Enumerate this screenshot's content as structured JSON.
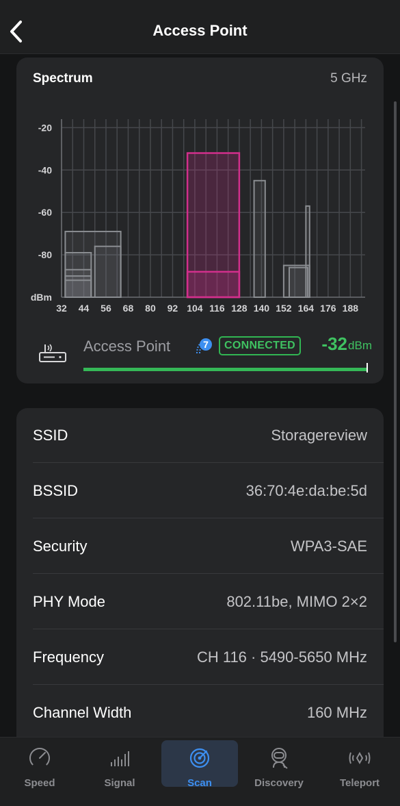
{
  "header": {
    "title": "Access Point",
    "back_icon": "chevron-left-icon"
  },
  "spectrum": {
    "title": "Spectrum",
    "band": "5 GHz",
    "chart_data": {
      "type": "bar",
      "xlabel": "",
      "ylabel": "dBm",
      "x_ticks": [
        "32",
        "44",
        "56",
        "68",
        "80",
        "92",
        "104",
        "116",
        "128",
        "140",
        "152",
        "164",
        "176",
        "188"
      ],
      "y_ticks": [
        "-20",
        "-40",
        "-60",
        "-80"
      ],
      "xlim": [
        32,
        196
      ],
      "ylim": [
        -100,
        -16
      ],
      "grid": true,
      "series": [
        {
          "channels": [
            34,
            64
          ],
          "dbm": -69,
          "highlight": false
        },
        {
          "channels": [
            34,
            48
          ],
          "dbm": -79,
          "highlight": false
        },
        {
          "channels": [
            34,
            48
          ],
          "dbm": -87,
          "highlight": false
        },
        {
          "channels": [
            34,
            48
          ],
          "dbm": -90,
          "highlight": false
        },
        {
          "channels": [
            34,
            48
          ],
          "dbm": -92,
          "highlight": false
        },
        {
          "channels": [
            50,
            64
          ],
          "dbm": -76,
          "highlight": false
        },
        {
          "channels": [
            100,
            128
          ],
          "dbm": -32,
          "highlight": true
        },
        {
          "channels": [
            100,
            128
          ],
          "dbm": -88,
          "highlight": true
        },
        {
          "channels": [
            136,
            142
          ],
          "dbm": -45,
          "highlight": false
        },
        {
          "channels": [
            152,
            166
          ],
          "dbm": -85,
          "highlight": false
        },
        {
          "channels": [
            155,
            165
          ],
          "dbm": -86,
          "highlight": false
        },
        {
          "channels": [
            164,
            166
          ],
          "dbm": -57,
          "highlight": false
        }
      ],
      "colors": {
        "highlight": "#d22f8c",
        "other": "#8a8d91",
        "grid": "#46484c"
      }
    }
  },
  "access_point": {
    "name": "Access Point",
    "wifi_gen_badge": "7",
    "status": "CONNECTED",
    "signal_value": "-32",
    "signal_unit": "dBm",
    "signal_fill_percent": 100,
    "icon": "router-icon"
  },
  "details": [
    {
      "label": "SSID",
      "value": "Storagereview"
    },
    {
      "label": "BSSID",
      "value": "36:70:4e:da:be:5d"
    },
    {
      "label": "Security",
      "value": "WPA3-SAE"
    },
    {
      "label": "PHY Mode",
      "value": "802.11be, MIMO 2×2"
    },
    {
      "label": "Frequency",
      "value": "CH 116 · 5490-5650 MHz"
    },
    {
      "label": "Channel Width",
      "value": "160 MHz"
    }
  ],
  "tabs": [
    {
      "label": "Speed",
      "icon": "speedometer-icon",
      "active": false
    },
    {
      "label": "Signal",
      "icon": "signal-bars-icon",
      "active": false
    },
    {
      "label": "Scan",
      "icon": "radar-icon",
      "active": true
    },
    {
      "label": "Discovery",
      "icon": "astronaut-icon",
      "active": false
    },
    {
      "label": "Teleport",
      "icon": "teleport-icon",
      "active": false
    }
  ],
  "colors": {
    "accent": "#3d8ff0",
    "connected": "#3fc261",
    "card": "#252628"
  }
}
